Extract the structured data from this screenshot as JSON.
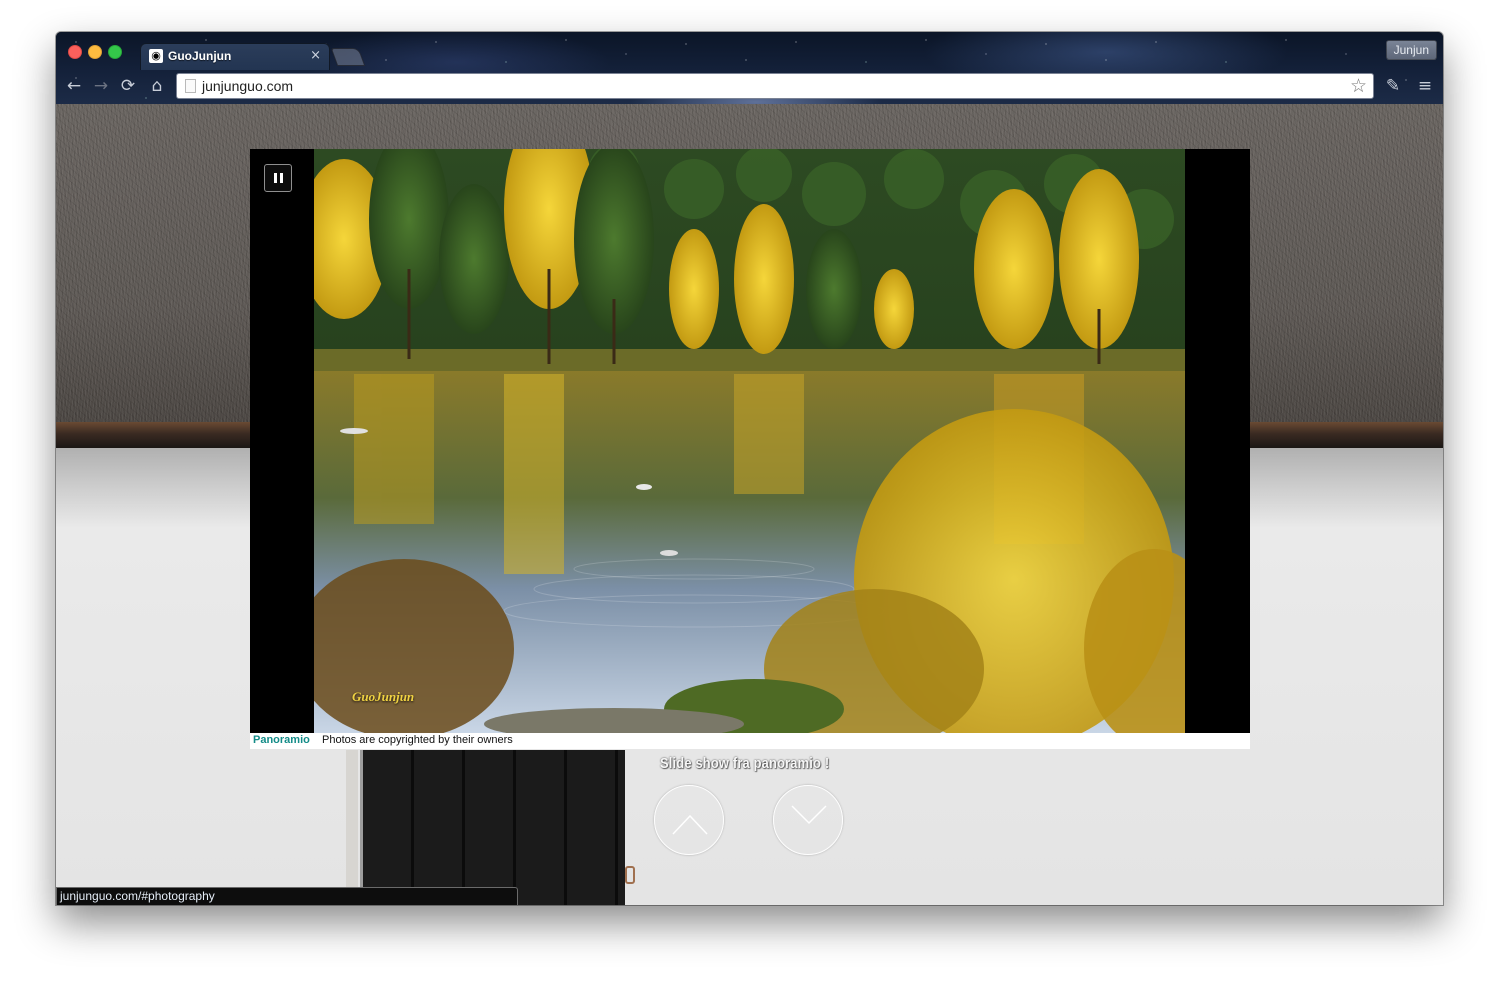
{
  "browser": {
    "tab_title": "GuoJunjun",
    "tab_favicon": "camera-icon",
    "close_icon": "×",
    "url": "junjunguo.com",
    "profile_name": "Junjun",
    "icons": {
      "back": "←",
      "forward": "→",
      "reload": "⟳",
      "home": "⌂",
      "bookmark": "☆",
      "extension": "✎",
      "menu": "≡"
    },
    "traffic_lights": {
      "close": "#fc605c",
      "minimize": "#fdbc40",
      "zoom": "#34c84a"
    }
  },
  "slideshow": {
    "watermark": "GuoJunjun",
    "provider": "Panoramio",
    "credit": "Photos are copyrighted by their owners",
    "caption": "Slide show fra panoramio !",
    "controls": {
      "pause": "pause-icon",
      "previous": "chevron-up-icon",
      "next": "chevron-down-icon"
    }
  },
  "status_bar": {
    "link": "junjunguo.com/#photography"
  },
  "colors": {
    "panoramio_brand": "#148c88",
    "watermark": "#f0d242"
  }
}
